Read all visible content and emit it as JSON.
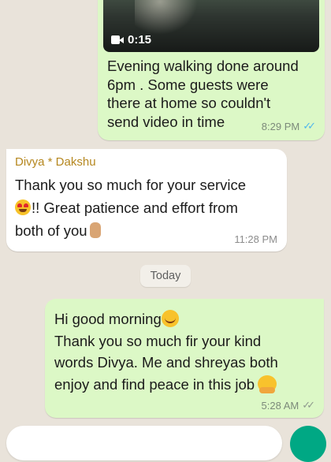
{
  "messages": [
    {
      "direction": "outgoing",
      "video_duration": "0:15",
      "text": "Evening walking done around\n6pm . Some guests were\nthere at home so couldn't\nsend video in time",
      "time": "8:29 PM",
      "status": "read"
    },
    {
      "direction": "incoming",
      "sender": "Divya * Dakshu",
      "text_line1": "Thank you so much for your service",
      "text_line2": "!! Great patience and effort from",
      "text_line3": "both of you",
      "time": "11:28 PM"
    },
    {
      "direction": "outgoing",
      "text_line1": "Hi good morning",
      "text_rest": "Thank you so much fir your kind\nwords Divya. Me and shreyas both\nenjoy and find peace in this job",
      "time": "5:28 AM",
      "status": "sent"
    }
  ],
  "date_separator": "Today",
  "colors": {
    "background": "#e9e3da",
    "outgoing_bubble": "#dcf8c6",
    "incoming_bubble": "#ffffff",
    "sender_name": "#b5871f",
    "read_ticks": "#4fb6ec",
    "send_button": "#00a884"
  },
  "icons": {
    "video": "video-camera-icon",
    "read": "double-check-icon",
    "send": "send-icon"
  }
}
